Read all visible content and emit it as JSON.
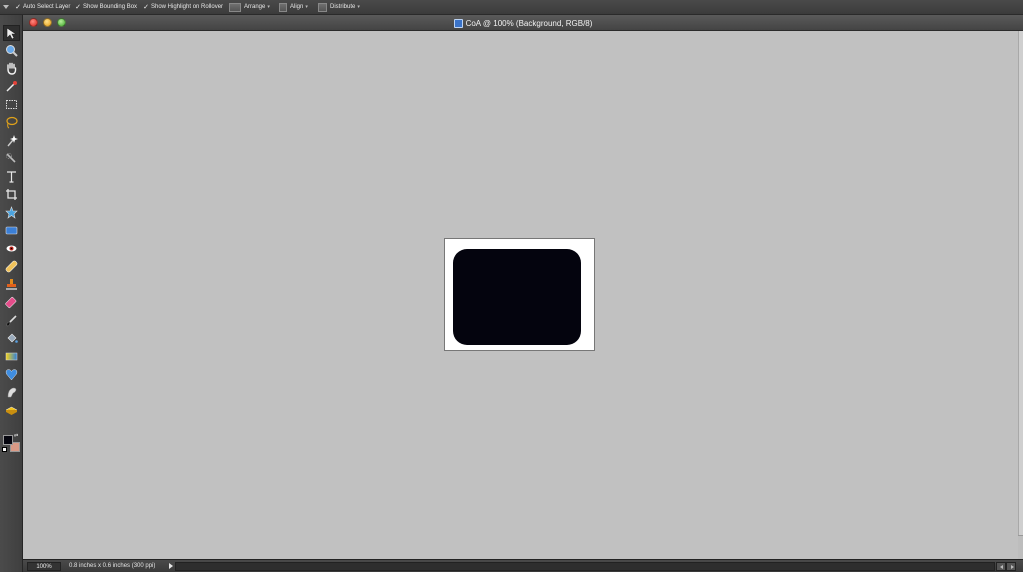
{
  "options_bar": {
    "auto_select_layer": {
      "label": "Auto Select Layer",
      "checked": true
    },
    "show_bounding_box": {
      "label": "Show Bounding Box",
      "checked": true
    },
    "show_highlight": {
      "label": "Show Highlight on Rollover",
      "checked": true
    },
    "arrange_label": "Arrange",
    "align_label": "Align",
    "distribute_label": "Distribute",
    "check_glyph": "✓",
    "caret_glyph": "▾"
  },
  "toolbar": {
    "tools": [
      {
        "name": "move-tool-icon",
        "active": true
      },
      {
        "name": "zoom-tool-icon"
      },
      {
        "name": "hand-tool-icon"
      },
      {
        "name": "eyedropper-tool-icon"
      },
      {
        "name": "marquee-tool-icon"
      },
      {
        "name": "lasso-tool-icon"
      },
      {
        "name": "magic-wand-tool-icon"
      },
      {
        "name": "quick-selection-tool-icon"
      },
      {
        "name": "type-tool-icon"
      },
      {
        "name": "crop-tool-icon"
      },
      {
        "name": "cookie-cutter-tool-icon"
      },
      {
        "name": "straighten-tool-icon"
      },
      {
        "name": "red-eye-tool-icon"
      },
      {
        "name": "healing-brush-tool-icon"
      },
      {
        "name": "clone-stamp-tool-icon"
      },
      {
        "name": "eraser-tool-icon"
      },
      {
        "name": "brush-tool-icon"
      },
      {
        "name": "paint-bucket-tool-icon"
      },
      {
        "name": "gradient-tool-icon"
      },
      {
        "name": "shape-tool-icon"
      },
      {
        "name": "smudge-tool-icon"
      },
      {
        "name": "sponge-tool-icon"
      }
    ],
    "foreground_color": "#06060f",
    "background_color": "#d99a86"
  },
  "document": {
    "title": "CoA @ 100% (Background, RGB/8)",
    "canvas_background": "#ffffff",
    "shape_color": "#04040e",
    "workspace_color": "#c1c1c1"
  },
  "status_bar": {
    "zoom": "100%",
    "doc_info": "0.8 inches x 0.6 inches (300 ppi)"
  }
}
